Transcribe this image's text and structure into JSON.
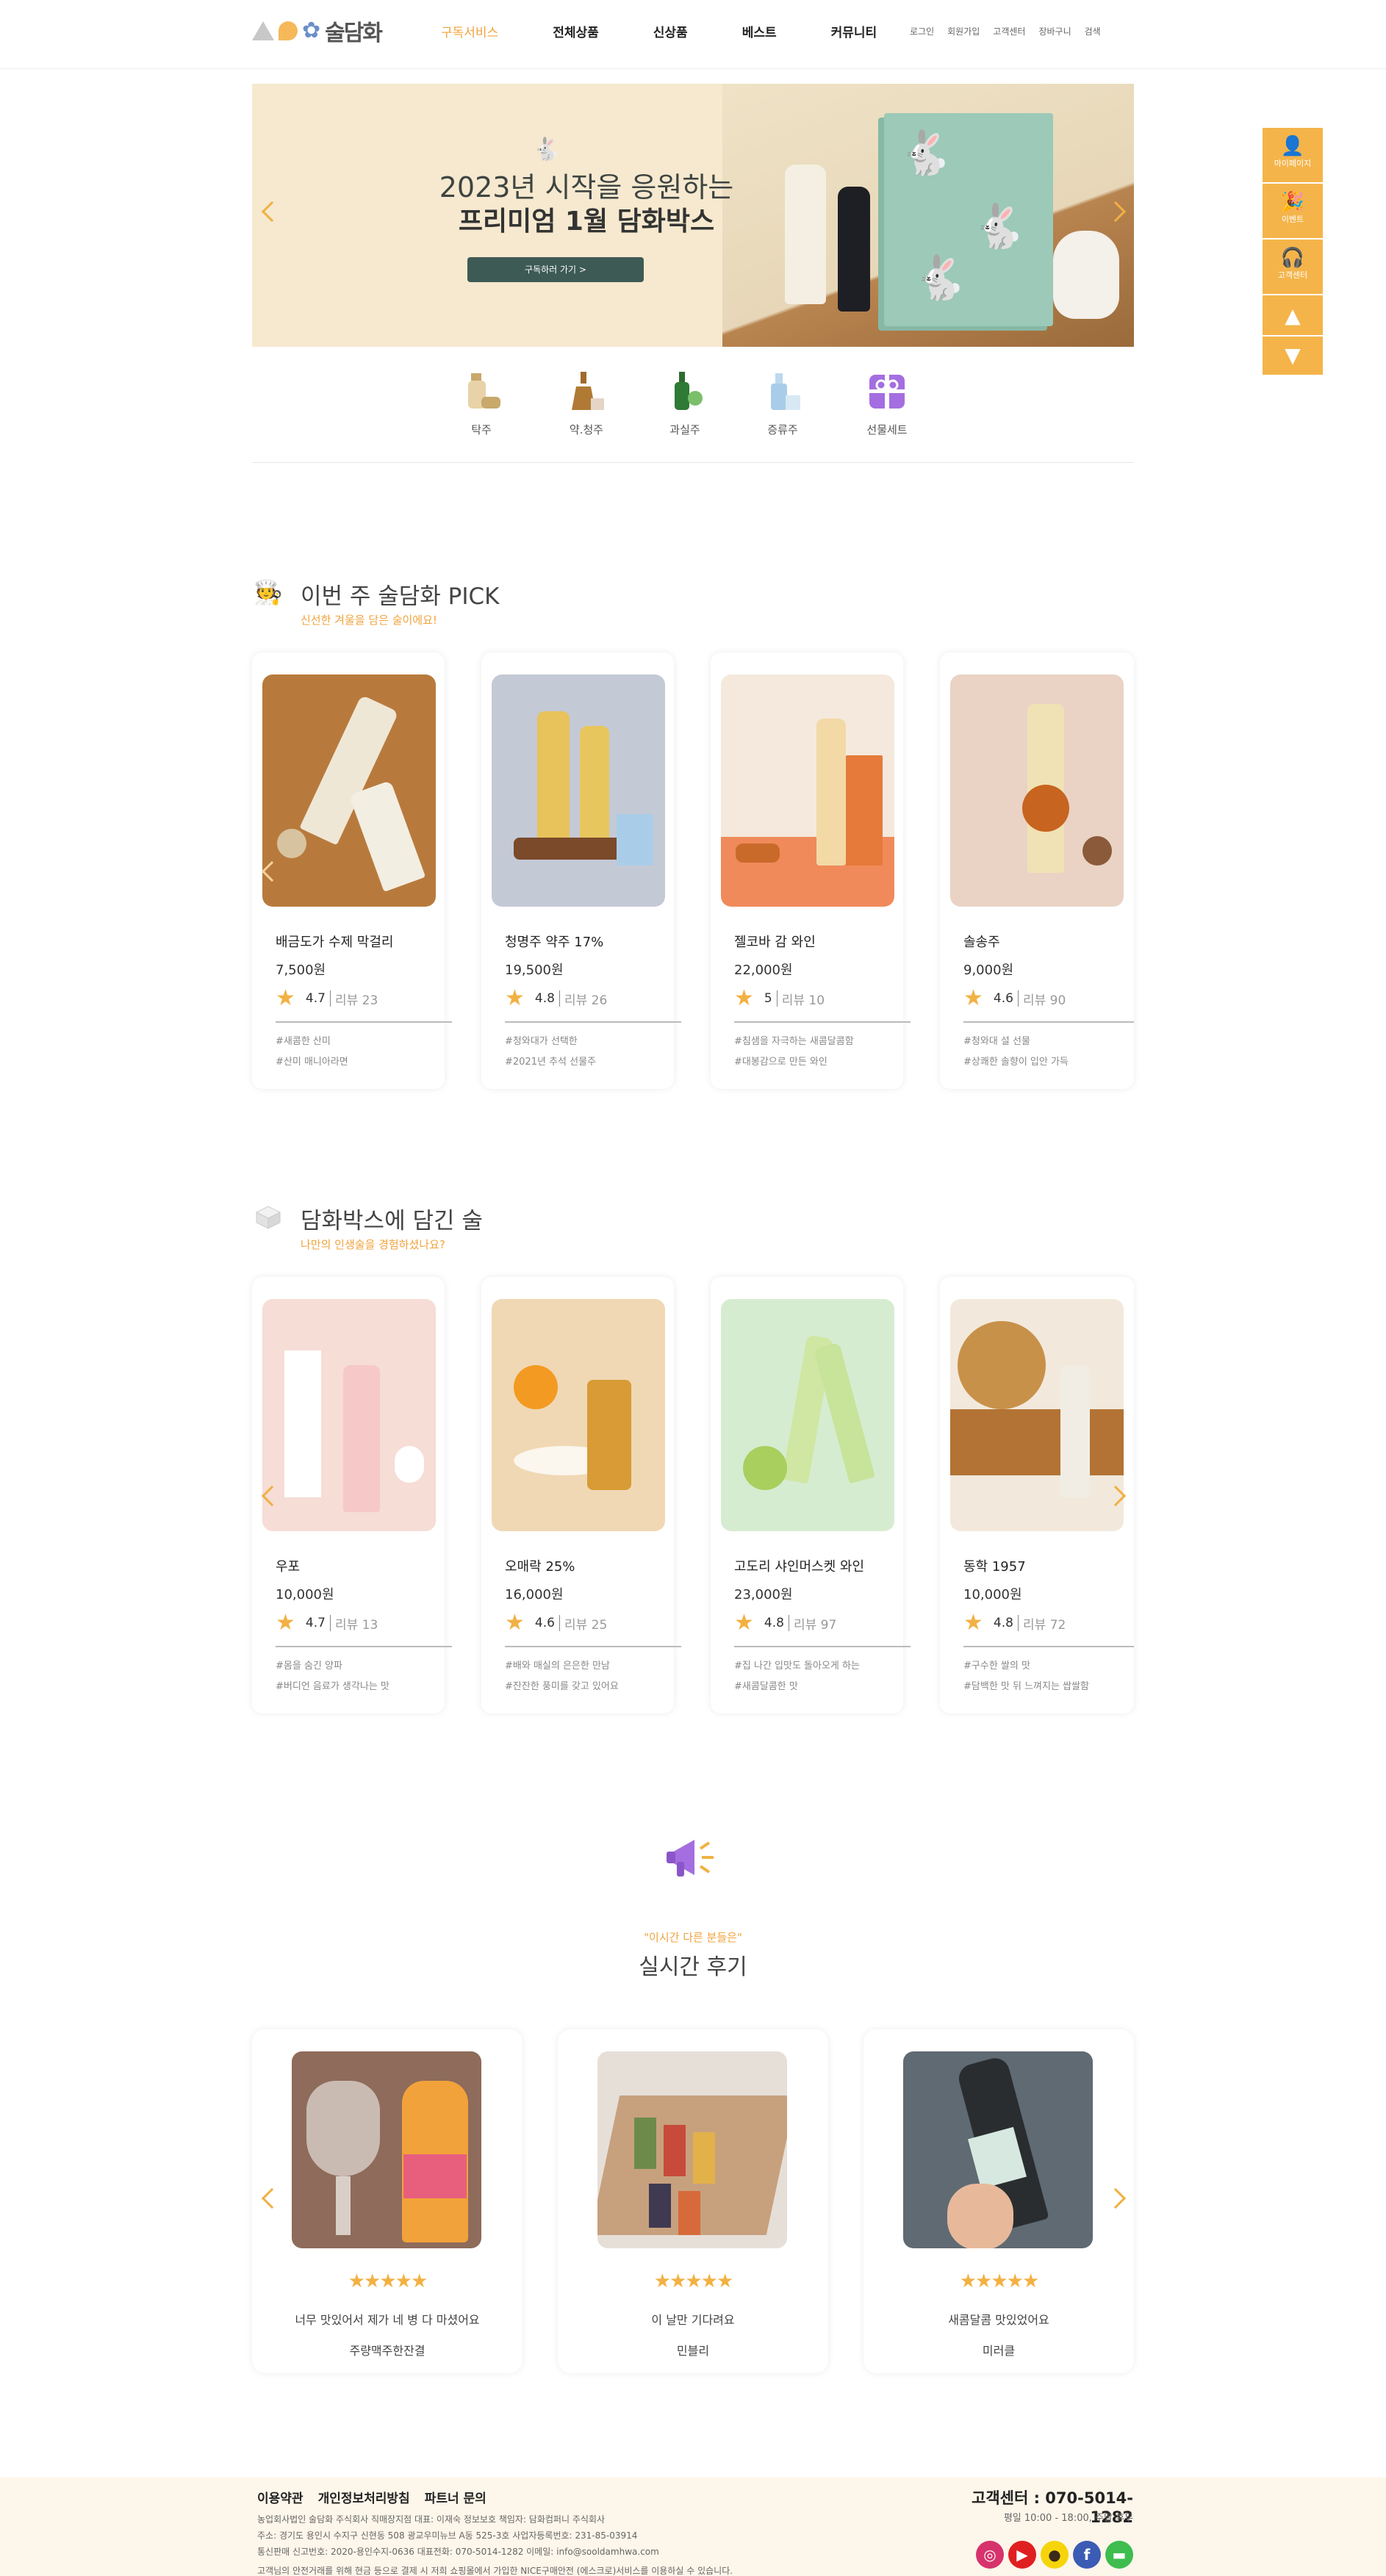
{
  "header": {
    "logo_text": "술담화",
    "nav": [
      "구독서비스",
      "전체상품",
      "신상품",
      "베스트",
      "커뮤니티"
    ],
    "util": [
      "로그인",
      "회원가입",
      "고객센터",
      "장바구니",
      "검색"
    ]
  },
  "banner": {
    "title_line1": "2023년 시작을 응원하는",
    "title_line2": "프리미엄 1월 담화박스",
    "button": "구독하러 가기 >"
  },
  "categories": [
    "탁주",
    "약.청주",
    "과실주",
    "증류주",
    "선물세트"
  ],
  "pick": {
    "title": "이번 주 술담화 PICK",
    "subtitle": "신선한 겨울을 담은 술이에요!",
    "products": [
      {
        "name": "배금도가 수제 막걸리",
        "price": "7,500원",
        "rating": "4.7",
        "reviews": "리뷰 23",
        "tags": [
          "#새콤한 산미",
          "#산미 매니아라면"
        ]
      },
      {
        "name": "청명주 약주 17%",
        "price": "19,500원",
        "rating": "4.8",
        "reviews": "리뷰 26",
        "tags": [
          "#청와대가 선택한",
          "#2021년 추석 선물주"
        ]
      },
      {
        "name": "젤코바 감 와인",
        "price": "22,000원",
        "rating": "5",
        "reviews": "리뷰 10",
        "tags": [
          "#침샘을 자극하는 새콤달콤함",
          "#대봉감으로 만든 와인"
        ]
      },
      {
        "name": "솔송주",
        "price": "9,000원",
        "rating": "4.6",
        "reviews": "리뷰 90",
        "tags": [
          "#청와대 설 선물",
          "#상쾌한 솔향이 입안 가득"
        ]
      }
    ]
  },
  "box": {
    "title": "담화박스에 담긴 술",
    "subtitle": "나만의 인생술을 경험하셨나요?",
    "products": [
      {
        "name": "우포",
        "price": "10,000원",
        "rating": "4.7",
        "reviews": "리뷰 13",
        "tags": [
          "#몸을 숨긴 양파",
          "#버디언 음료가 생각나는 맛"
        ]
      },
      {
        "name": "오매락 25%",
        "price": "16,000원",
        "rating": "4.6",
        "reviews": "리뷰 25",
        "tags": [
          "#배와 매실의 은은한 만남",
          "#잔잔한 풍미를 갖고 있어요"
        ]
      },
      {
        "name": "고도리 샤인머스켓 와인",
        "price": "23,000원",
        "rating": "4.8",
        "reviews": "리뷰 97",
        "tags": [
          "#집 나간 입맛도 돌아오게 하는",
          "#새콤달콤한 맛"
        ]
      },
      {
        "name": "동학 1957",
        "price": "10,000원",
        "rating": "4.8",
        "reviews": "리뷰 72",
        "tags": [
          "#구수한 쌀의 맛",
          "#담백한 맛 뒤 느껴지는 쌉쌀함"
        ]
      }
    ]
  },
  "reviews": {
    "kicker": "\"이시간 다른 분들은\"",
    "title": "실시간 후기",
    "items": [
      {
        "stars": "★★★★★",
        "text": "너무 맛있어서 제가 네 병 다 마셨어요",
        "author": "주량맥주한잔결"
      },
      {
        "stars": "★★★★★",
        "text": "이 날만 기다려요",
        "author": "민블리"
      },
      {
        "stars": "★★★★★",
        "text": "새콤달콤 맛있었어요",
        "author": "미러클"
      }
    ]
  },
  "side_menu": [
    "마이페이지",
    "이벤트",
    "고객센터"
  ],
  "footer": {
    "links": [
      "이용약관",
      "개인정보처리방침",
      "파트너 문의"
    ],
    "info1": "농업회사법인 술담화 주식회사 직매장지점 대표: 이재숙 정보보호 책임자: 담화컴퍼니 주식회사",
    "info2": "주소: 경기도 용인시 수지구 신현동 508 광교우미뉴브 A동 525-3호 사업자등록번호: 231-85-03914",
    "info3": "통신판매 신고번호: 2020-용인수지-0636 대표전화: 070-5014-1282 이메일: info@sooldamhwa.com",
    "notice": "고객님의 안전거래를 위해 현금 등으로 결제 시 저희 쇼핑몰에서 가입한 NICE구매안전 (에스크로)서비스를 이용하실 수 있습니다.",
    "cs": "고객센터 : 070-5014-1282",
    "hours": "평일 10:00 - 18:00, 주말 휴무",
    "sns": [
      "instagram-icon",
      "youtube-icon",
      "kakaotalk-icon",
      "facebook-icon",
      "line-icon"
    ]
  }
}
